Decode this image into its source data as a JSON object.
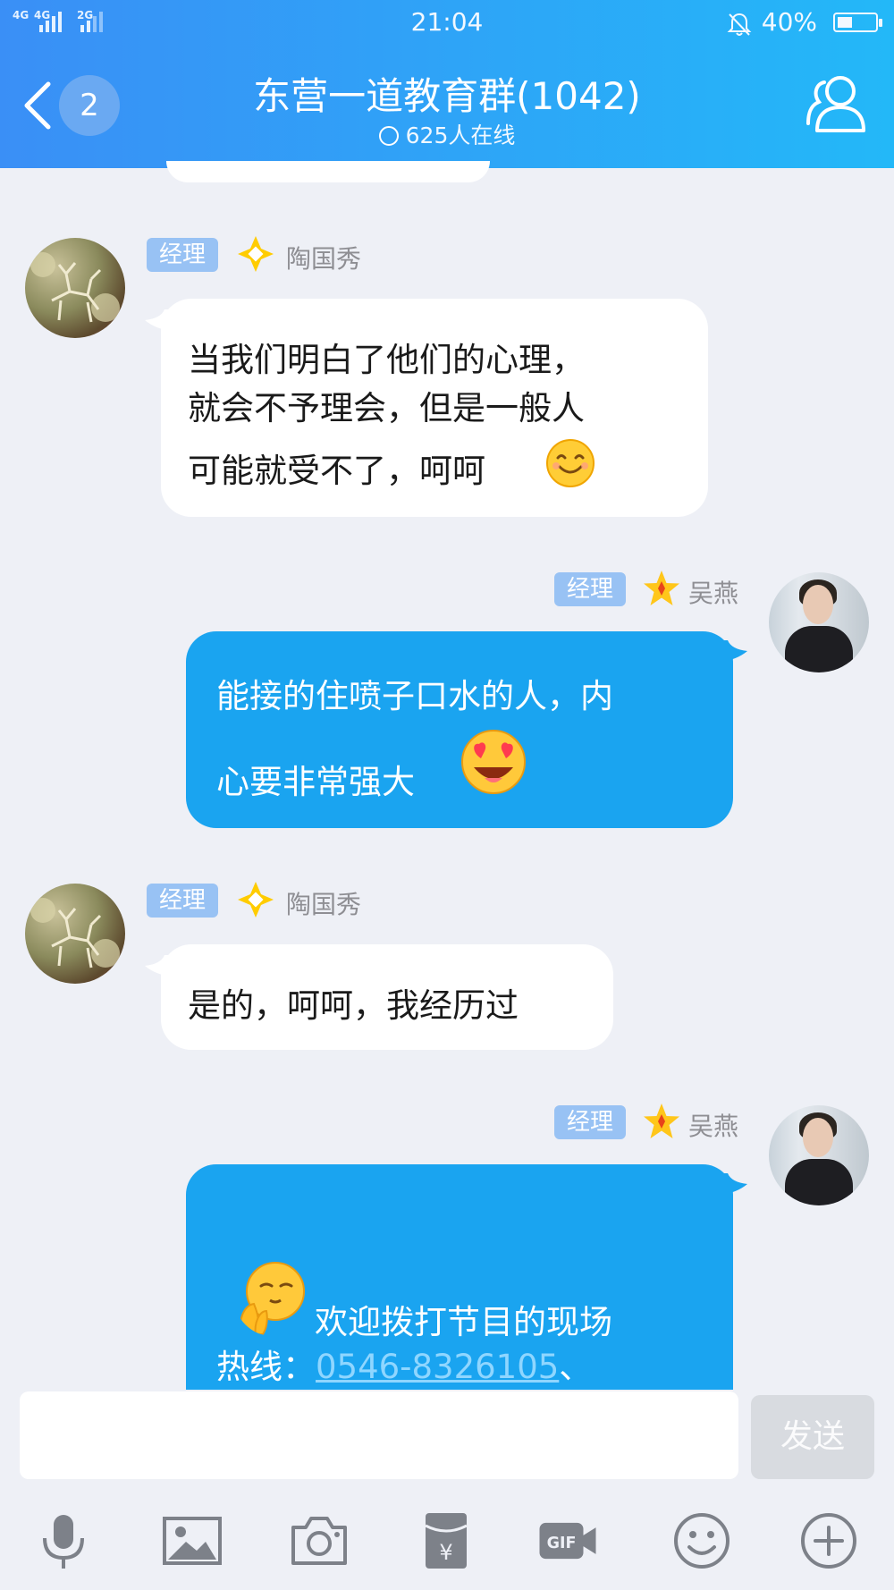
{
  "status_bar": {
    "signal1": "4G",
    "signal2": "4G",
    "signal3": "2G",
    "time": "21:04",
    "battery": "40%",
    "battery_level": 0.4
  },
  "header": {
    "unread_count": "2",
    "title": "东营一道教育群(1042)",
    "online": "625人在线"
  },
  "messages": [
    {
      "side": "left",
      "tag": "经理",
      "sender": "陶国秀",
      "lines": [
        "当我们明白了他们的心理，",
        "就会不予理会，但是一般人",
        "可能就受不了，呵呵"
      ],
      "emoji": "smile-emoji"
    },
    {
      "side": "right",
      "tag": "经理",
      "sender": "吴燕",
      "lines": [
        "能接的住喷子口水的人，内",
        "心要非常强大"
      ],
      "emoji": "heart-eyes-emoji"
    },
    {
      "side": "left",
      "tag": "经理",
      "sender": "陶国秀",
      "lines": [
        "是的，呵呵，我经历过"
      ]
    },
    {
      "side": "right",
      "tag": "经理",
      "sender": "吴燕",
      "lines": [
        "欢迎拨打节目的现场",
        "热线："
      ],
      "phone": "0546-8326105",
      "after_phone": "、",
      "emoji": "shy-emoji"
    }
  ],
  "input": {
    "placeholder": "",
    "send_label": "发送"
  },
  "toolbar": [
    "microphone-icon",
    "image-icon",
    "camera-icon",
    "red-packet-icon",
    "gif-icon",
    "emoji-icon",
    "plus-icon"
  ],
  "colors": {
    "header_start": "#3a8ff6",
    "header_end": "#23b8f8",
    "own_bubble": "#1aa4f0",
    "tag": "#98c2f4",
    "background": "#eef0f6"
  }
}
